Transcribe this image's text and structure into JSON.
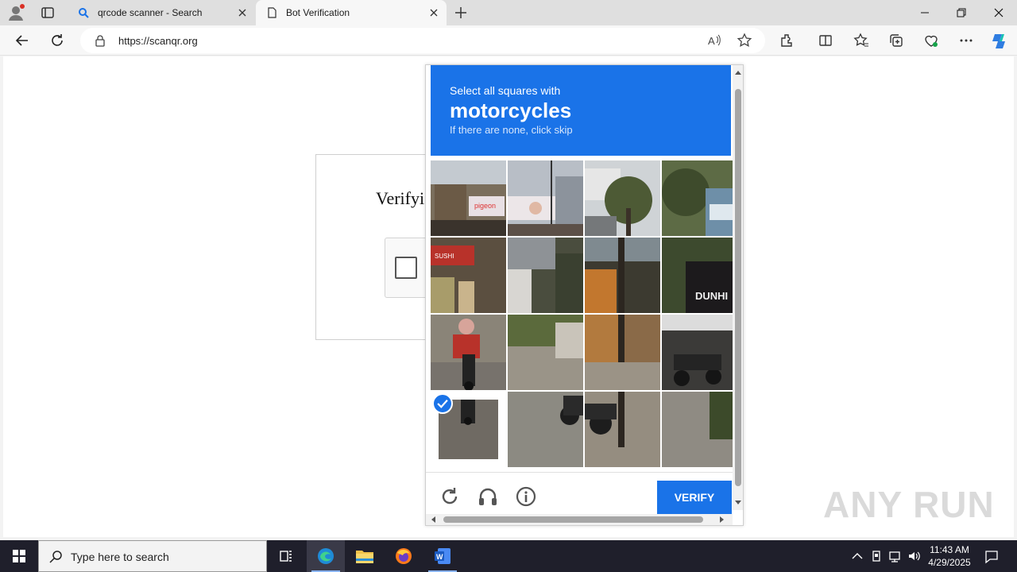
{
  "browser": {
    "tabs": [
      {
        "label": "qrcode scanner - Search",
        "icon": "search-icon"
      },
      {
        "label": "Bot Verification",
        "icon": "page-icon"
      }
    ],
    "address": "https://scanqr.org"
  },
  "page": {
    "verify_title": "Verifyi"
  },
  "captcha": {
    "instruction": "Select all squares with",
    "target": "motorcycles",
    "hint": "If there are none, click skip",
    "verify_label": "VERIFY",
    "selected_tiles": [
      12
    ],
    "footer_icons": [
      "reload-icon",
      "audio-icon",
      "info-icon"
    ]
  },
  "watermark": "ANY RUN",
  "taskbar": {
    "search_placeholder": "Type here to search",
    "time": "11:43 AM",
    "date": "4/29/2025",
    "apps": [
      "task-view-icon",
      "edge-icon",
      "file-explorer-icon",
      "firefox-icon",
      "word-icon"
    ]
  },
  "colors": {
    "accent": "#1a73e8",
    "taskbar": "#1f1f2b"
  }
}
